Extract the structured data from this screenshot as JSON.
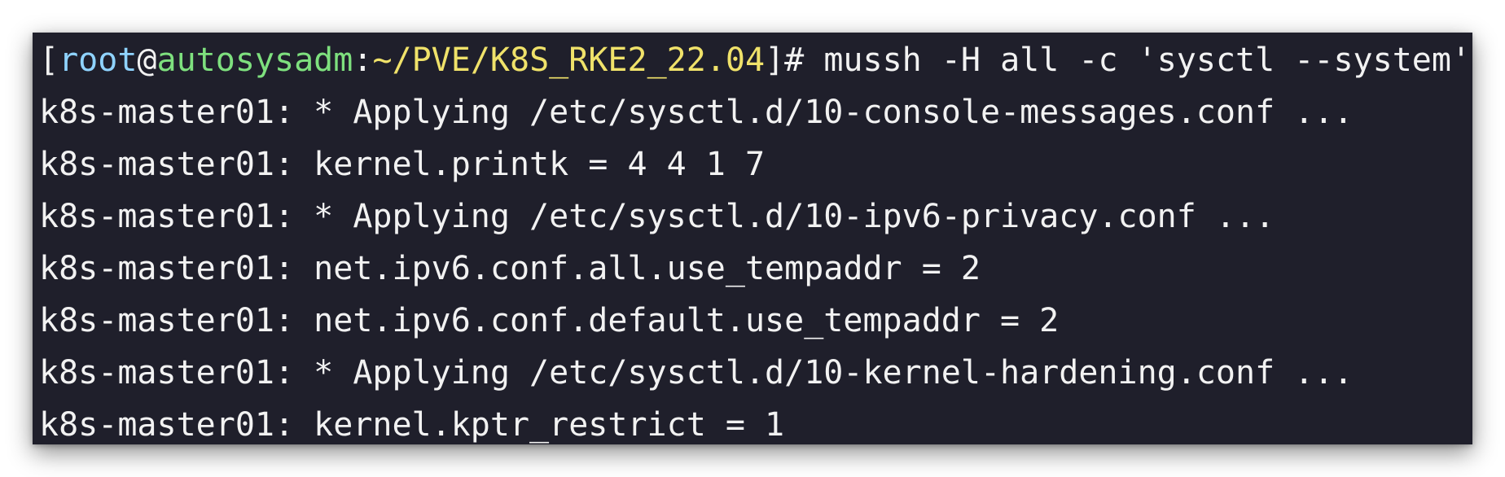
{
  "prompt": {
    "open_bracket": "[",
    "user": "root",
    "at": "@",
    "host": "autosysadm",
    "colon": ":",
    "path": "~/PVE/K8S_RKE2_22.04",
    "close": "]# ",
    "command": "mussh -H all -c 'sysctl --system'"
  },
  "output_lines": [
    "k8s-master01: * Applying /etc/sysctl.d/10-console-messages.conf ...",
    "k8s-master01: kernel.printk = 4 4 1 7",
    "k8s-master01: * Applying /etc/sysctl.d/10-ipv6-privacy.conf ...",
    "k8s-master01: net.ipv6.conf.all.use_tempaddr = 2",
    "k8s-master01: net.ipv6.conf.default.use_tempaddr = 2",
    "k8s-master01: * Applying /etc/sysctl.d/10-kernel-hardening.conf ...",
    "k8s-master01: kernel.kptr_restrict = 1"
  ],
  "colors": {
    "background": "#1f1f2b",
    "text": "#f2f2f2",
    "user": "#8fd3ff",
    "host": "#7ee07e",
    "path": "#f0e26a"
  }
}
